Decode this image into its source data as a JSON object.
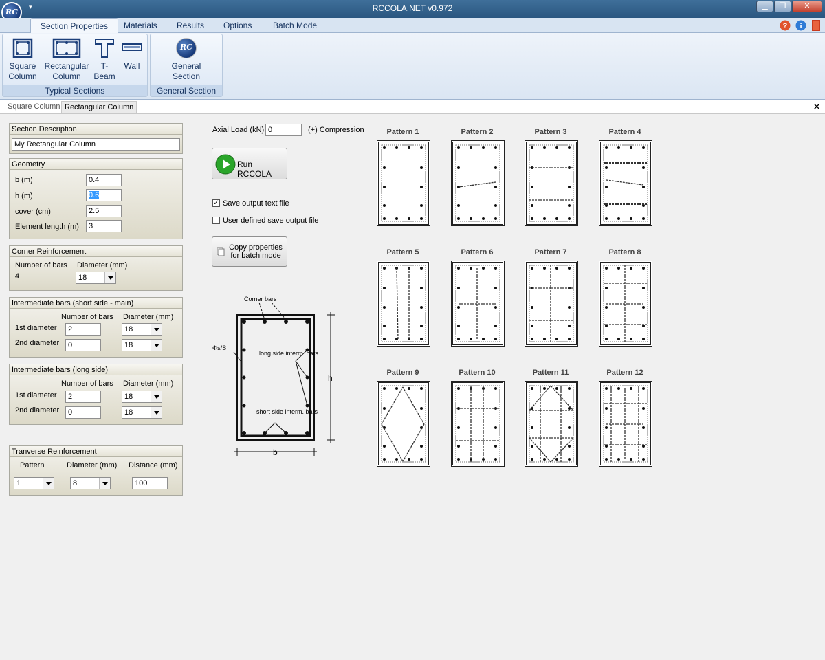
{
  "app": {
    "title": "RCCOLA.NET v0.972",
    "logo": "RC"
  },
  "menu": [
    "Section Properties",
    "Materials",
    "Results",
    "Options",
    "Batch Mode"
  ],
  "ribbon": {
    "typical": {
      "label": "Typical Sections",
      "items": [
        "Square Column",
        "Rectangular Column",
        "T- Beam",
        "Wall"
      ]
    },
    "general": {
      "label": "General Section",
      "items": [
        "General Section"
      ]
    }
  },
  "doc_tabs": [
    "Square Column",
    "Rectangular Column"
  ],
  "section_description": {
    "header": "Section Description",
    "value": "My Rectangular Column"
  },
  "geometry": {
    "header": "Geometry",
    "fields": [
      {
        "label": "b (m)",
        "value": "0.4"
      },
      {
        "label": "h (m)",
        "value": "0.6"
      },
      {
        "label": "cover (cm)",
        "value": "2.5"
      },
      {
        "label": "Element length (m)",
        "value": "3"
      }
    ]
  },
  "corner": {
    "header": "Corner Reinforcement",
    "num_label": "Number of bars",
    "num_value": "4",
    "dia_label": "Diameter (mm)",
    "dia_value": "18"
  },
  "inter_short": {
    "header": "Intermediate bars (short side - main)",
    "num_label": "Number of bars",
    "dia_label": "Diameter (mm)",
    "rows": [
      {
        "label": "1st diameter",
        "num": "2",
        "dia": "18"
      },
      {
        "label": "2nd diameter",
        "num": "0",
        "dia": "18"
      }
    ]
  },
  "inter_long": {
    "header": "Intermediate bars (long side)",
    "num_label": "Number of bars",
    "dia_label": "Diameter (mm)",
    "rows": [
      {
        "label": "1st diameter",
        "num": "2",
        "dia": "18"
      },
      {
        "label": "2nd diameter",
        "num": "0",
        "dia": "18"
      }
    ]
  },
  "transverse": {
    "header": "Tranverse Reinforcement",
    "pattern_label": "Pattern",
    "dia_label": "Diameter (mm)",
    "dist_label": "Distance (mm)",
    "pattern": "1",
    "dia": "8",
    "dist": "100"
  },
  "axial": {
    "label": "Axial Load (kN)",
    "value": "0",
    "note": "(+) Compression"
  },
  "run_button": "Run RCCOLA",
  "save_output": {
    "label": "Save output text file",
    "checked": true
  },
  "user_defined": {
    "label": "User defined save output file",
    "checked": false
  },
  "copy_button": "Copy properties for batch mode",
  "diagram": {
    "corner_bars": "Corner bars",
    "stirrup": "Φs/S",
    "long_side": "long side interm. bars",
    "short_side": "short side interm. bars",
    "h": "h",
    "b": "b"
  },
  "patterns": [
    "Pattern 1",
    "Pattern 2",
    "Pattern 3",
    "Pattern 4",
    "Pattern 5",
    "Pattern 6",
    "Pattern 7",
    "Pattern 8",
    "Pattern 9",
    "Pattern 10",
    "Pattern 11",
    "Pattern 12"
  ]
}
